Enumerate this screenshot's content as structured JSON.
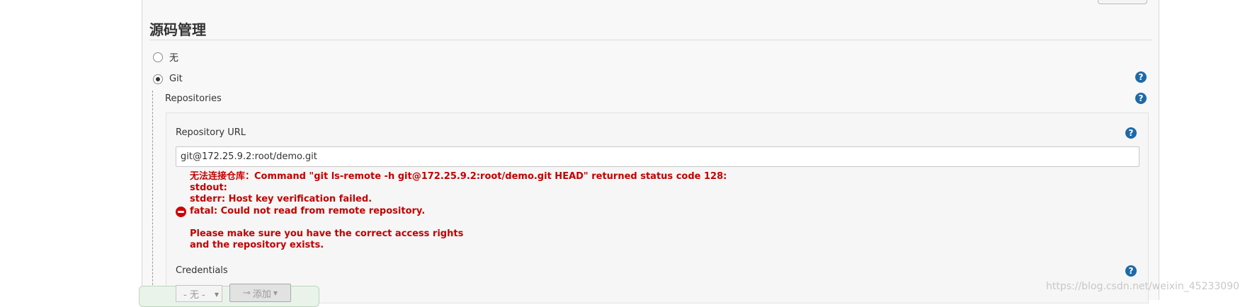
{
  "section": {
    "title": "源码管理"
  },
  "scm": {
    "options": [
      {
        "label": "无",
        "selected": false
      },
      {
        "label": "Git",
        "selected": true
      }
    ]
  },
  "git": {
    "repositories_label": "Repositories",
    "repository_url_label": "Repository URL",
    "repository_url_value": "git@172.25.9.2:root/demo.git",
    "error_lines": [
      "无法连接仓库：Command \"git ls-remote -h git@172.25.9.2:root/demo.git HEAD\" returned status code 128:",
      "stdout:",
      "stderr: Host key verification failed.",
      "fatal: Could not read from remote repository.",
      "",
      "Please make sure you have the correct access rights",
      "and the repository exists."
    ],
    "credentials_label": "Credentials",
    "credentials_select_value": "- 无 -",
    "add_button_label": "添加",
    "add_button_icon": "key-icon"
  },
  "help_icon_glyph": "?",
  "watermark": "https://blog.csdn.net/weixin_45233090",
  "colors": {
    "help": "#1e6aa8",
    "error": "#c30000"
  }
}
